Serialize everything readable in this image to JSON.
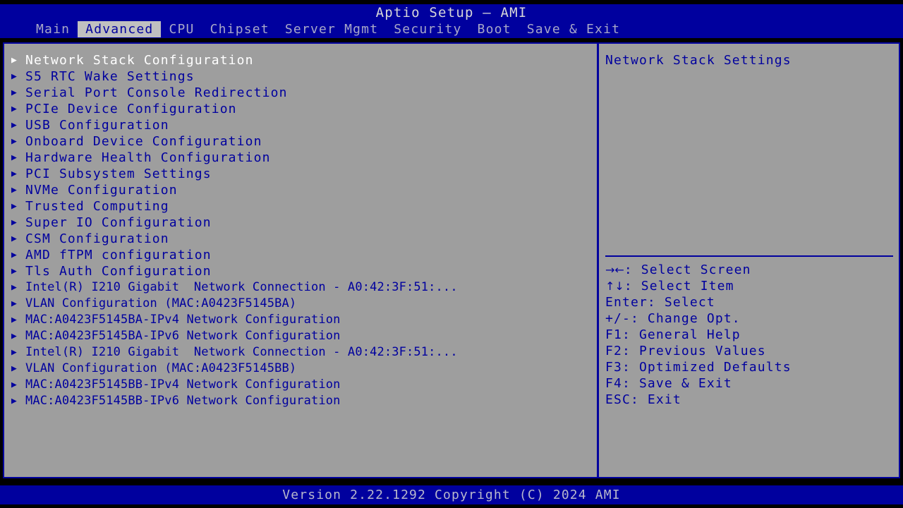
{
  "colors": {
    "screen_black": "#000000",
    "band_blue": "#00009e",
    "panel_gray": "#9e9e9e",
    "tab_active_bg": "#c0c0c0",
    "text_blue": "#00009e",
    "text_selected": "#ffffff",
    "text_header": "#d8d8d8",
    "text_tab_inactive": "#a8a8c8"
  },
  "header": {
    "title": "Aptio Setup – AMI",
    "tabs": [
      {
        "label": "Main",
        "active": false
      },
      {
        "label": "Advanced",
        "active": true
      },
      {
        "label": "CPU",
        "active": false
      },
      {
        "label": "Chipset",
        "active": false
      },
      {
        "label": "Server Mgmt",
        "active": false
      },
      {
        "label": "Security",
        "active": false
      },
      {
        "label": "Boot",
        "active": false
      },
      {
        "label": "Save & Exit",
        "active": false
      }
    ]
  },
  "menu": {
    "arrow_glyph": "▶",
    "items": [
      {
        "label": "Network Stack Configuration",
        "selected": true,
        "dense": false
      },
      {
        "label": "S5 RTC Wake Settings",
        "selected": false,
        "dense": false
      },
      {
        "label": "Serial Port Console Redirection",
        "selected": false,
        "dense": false
      },
      {
        "label": "PCIe Device Configuration",
        "selected": false,
        "dense": false
      },
      {
        "label": "USB Configuration",
        "selected": false,
        "dense": false
      },
      {
        "label": "Onboard Device Configuration",
        "selected": false,
        "dense": false
      },
      {
        "label": "Hardware Health Configuration",
        "selected": false,
        "dense": false
      },
      {
        "label": "PCI Subsystem Settings",
        "selected": false,
        "dense": false
      },
      {
        "label": "NVMe Configuration",
        "selected": false,
        "dense": false
      },
      {
        "label": "Trusted Computing",
        "selected": false,
        "dense": false
      },
      {
        "label": "Super IO Configuration",
        "selected": false,
        "dense": false
      },
      {
        "label": "CSM Configuration",
        "selected": false,
        "dense": false
      },
      {
        "label": "AMD fTPM configuration",
        "selected": false,
        "dense": false
      },
      {
        "label": "Tls Auth Configuration",
        "selected": false,
        "dense": false
      },
      {
        "label": "Intel(R) I210 Gigabit  Network Connection - A0:42:3F:51:...",
        "selected": false,
        "dense": true
      },
      {
        "label": "VLAN Configuration (MAC:A0423F5145BA)",
        "selected": false,
        "dense": true
      },
      {
        "label": "MAC:A0423F5145BA-IPv4 Network Configuration",
        "selected": false,
        "dense": true
      },
      {
        "label": "MAC:A0423F5145BA-IPv6 Network Configuration",
        "selected": false,
        "dense": true
      },
      {
        "label": "Intel(R) I210 Gigabit  Network Connection - A0:42:3F:51:...",
        "selected": false,
        "dense": true
      },
      {
        "label": "VLAN Configuration (MAC:A0423F5145BB)",
        "selected": false,
        "dense": true
      },
      {
        "label": "MAC:A0423F5145BB-IPv4 Network Configuration",
        "selected": false,
        "dense": true
      },
      {
        "label": "MAC:A0423F5145BB-IPv6 Network Configuration",
        "selected": false,
        "dense": true
      }
    ]
  },
  "help": {
    "description": "Network Stack Settings",
    "legend": [
      {
        "glyph": "→←",
        "text": ": Select Screen"
      },
      {
        "glyph": "↑↓",
        "text": ": Select Item"
      },
      {
        "glyph": "",
        "text": "Enter: Select"
      },
      {
        "glyph": "",
        "text": "+/-: Change Opt."
      },
      {
        "glyph": "",
        "text": "F1: General Help"
      },
      {
        "glyph": "",
        "text": "F2: Previous Values"
      },
      {
        "glyph": "",
        "text": "F3: Optimized Defaults"
      },
      {
        "glyph": "",
        "text": "F4: Save & Exit"
      },
      {
        "glyph": "",
        "text": "ESC: Exit"
      }
    ]
  },
  "footer": {
    "version_text": "Version 2.22.1292 Copyright (C) 2024 AMI"
  }
}
